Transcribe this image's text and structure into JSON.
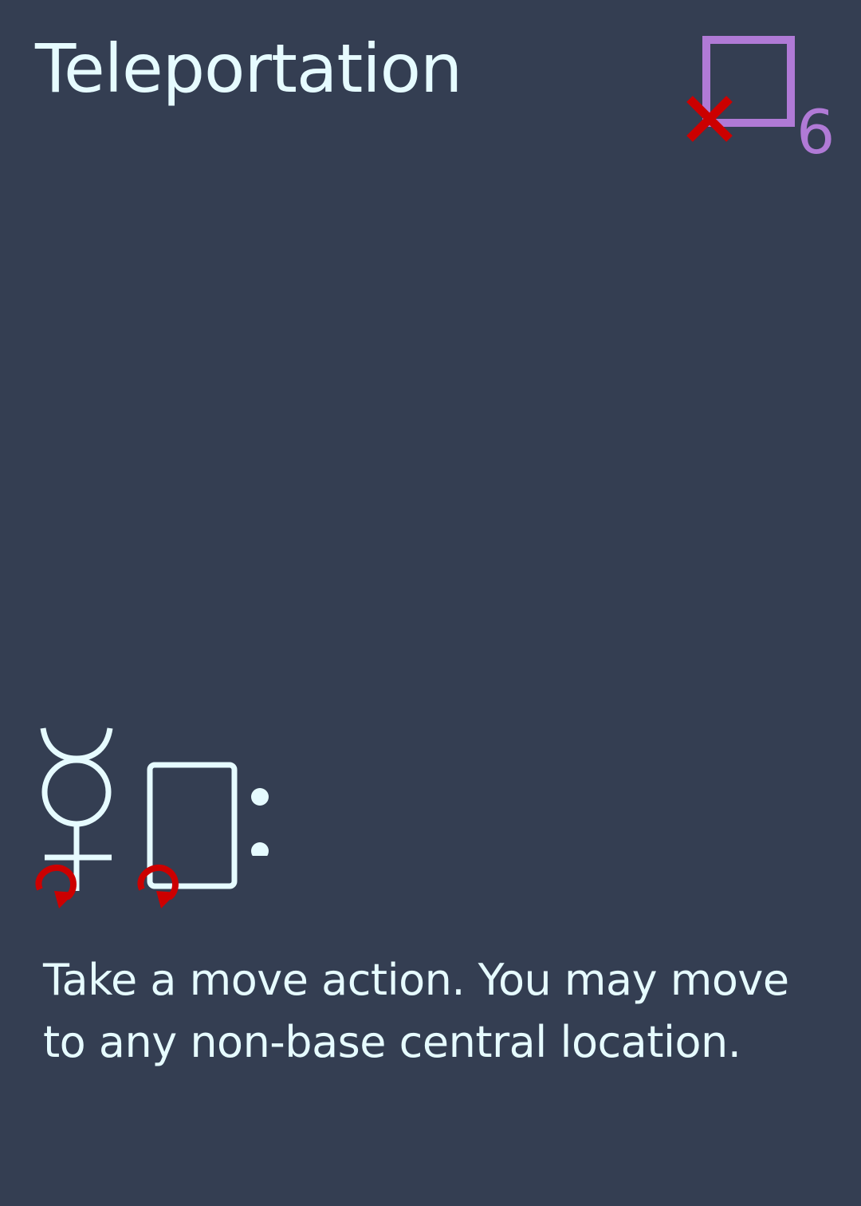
{
  "card": {
    "title": "Teleportation",
    "cost": {
      "value": "6",
      "icon": "purple-square-with-red-x-icon",
      "color": "#b07ad6",
      "mark_color": "#cc0000"
    },
    "icons": [
      {
        "name": "mercury-symbol-icon",
        "exhaust": "red-rotate-arrow-icon"
      },
      {
        "name": "card-icon",
        "exhaust": "red-rotate-arrow-icon"
      },
      {
        "name": "colon-icon"
      }
    ],
    "text": "Take a move action. You may move to any non-base central location."
  },
  "colors": {
    "background": "#343e52",
    "text": "#e6fbff",
    "accent": "#b07ad6",
    "red": "#cc0000"
  }
}
